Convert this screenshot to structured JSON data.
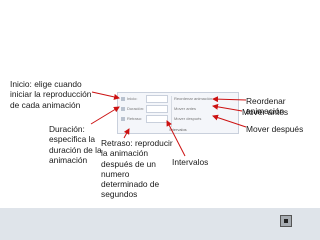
{
  "callouts": {
    "inicio": "Inicio: elige cuando\niniciar la reproducción\nde cada animación",
    "duracion": "Duración:\nespecifica la\nduración de la\nanimación",
    "retraso": "Retraso: reproducir\nla animación\ndespués de un\nnumero\ndeterminado de\nsegundos",
    "intervalos": "Intervalos",
    "reordenar": "Reordenar\nanimación",
    "mover_antes": "Mover antes",
    "mover_despues": "Mover después"
  },
  "ribbon": {
    "inicio": "Inicio:",
    "duracion": "Duración:",
    "retraso": "Retraso:",
    "reordenar": "Reordenar animación",
    "mover_antes": "Mover antes",
    "mover_despues": "Mover después",
    "group": "Intervalos"
  },
  "colors": {
    "arrow": "#cc1111",
    "bottom_band": "#dfe4ea"
  },
  "icons": {
    "nav": "slide-nav-button"
  }
}
